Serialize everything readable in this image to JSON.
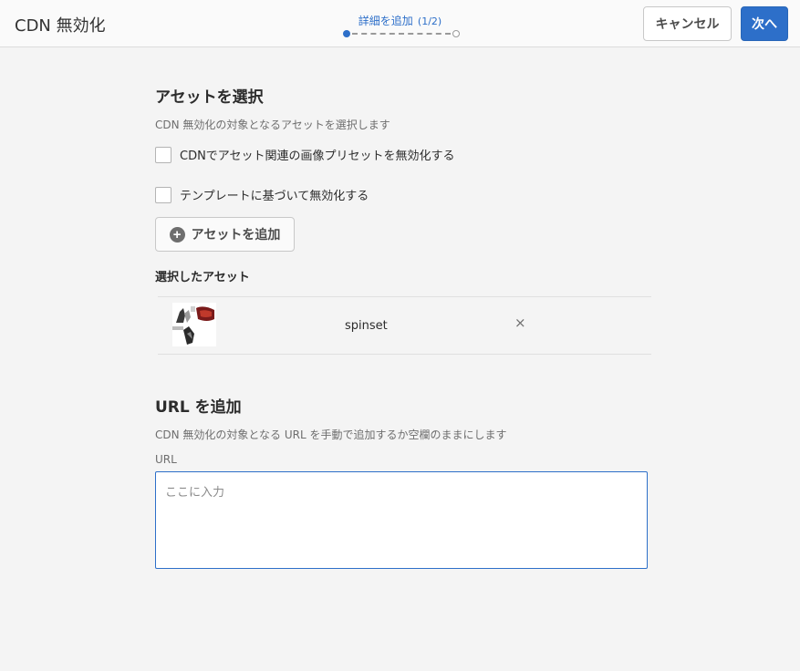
{
  "header": {
    "title": "CDN 無効化",
    "step_label": "詳細を追加",
    "step_count": "(1/2)",
    "cancel_label": "キャンセル",
    "next_label": "次へ"
  },
  "assets_section": {
    "title": "アセットを選択",
    "description": "CDN 無効化の対象となるアセットを選択します",
    "checkboxes": [
      {
        "label": "CDNでアセット関連の画像プリセットを無効化する",
        "checked": false
      },
      {
        "label": "テンプレートに基づいて無効化する",
        "checked": false
      }
    ],
    "add_button_label": "アセットを追加",
    "add_icon": "+",
    "selected_heading": "選択したアセット",
    "selected_assets": [
      {
        "name": "spinset",
        "remove_icon": "×"
      }
    ]
  },
  "url_section": {
    "title": "URL を追加",
    "description": "CDN 無効化の対象となる URL を手動で追加するか空欄のままにします",
    "field_label": "URL",
    "placeholder": "ここに入力",
    "value": ""
  },
  "colors": {
    "accent": "#2d6fc9",
    "background": "#f4f4f4",
    "header_bg": "#fafafa"
  }
}
